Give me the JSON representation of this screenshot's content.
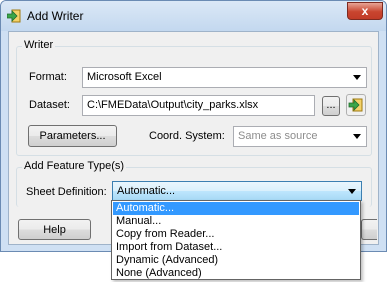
{
  "window": {
    "title": "Add Writer",
    "close_label": "x"
  },
  "writer_group": {
    "label": "Writer",
    "format_label": "Format:",
    "format_value": "Microsoft Excel",
    "dataset_label": "Dataset:",
    "dataset_value": "C:\\FMEData\\Output\\city_parks.xlsx",
    "browse_label": "...",
    "parameters_label": "Parameters...",
    "coord_system_label": "Coord. System:",
    "coord_system_value": "Same as source"
  },
  "feature_type_group": {
    "label": "Add Feature Type(s)",
    "sheet_definition_label": "Sheet Definition:",
    "sheet_definition_value": "Automatic..."
  },
  "buttons": {
    "help_label": "Help"
  },
  "dropdown": {
    "options": [
      "Automatic...",
      "Manual...",
      "Copy from Reader...",
      "Import from Dataset...",
      "Dynamic (Advanced)",
      "None (Advanced)"
    ],
    "selected": "Automatic..."
  },
  "colors": {
    "selection": "#3399ff",
    "close_button": "#c9452f"
  }
}
